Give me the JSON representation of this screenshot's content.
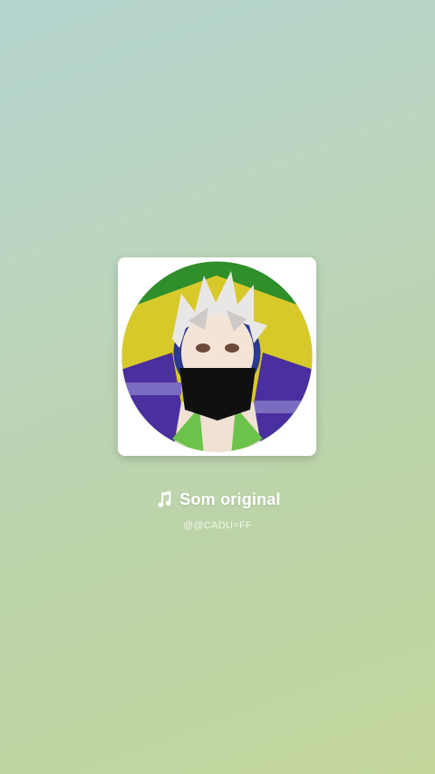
{
  "sound": {
    "title": "Som original",
    "artist": "@@CADU=FF",
    "icon": "music-note-icon",
    "cover_alt": "avatar artwork"
  },
  "colors": {
    "background_top": "#b4d4cf",
    "background_bottom": "#c3d79c",
    "text": "#ffffff"
  }
}
